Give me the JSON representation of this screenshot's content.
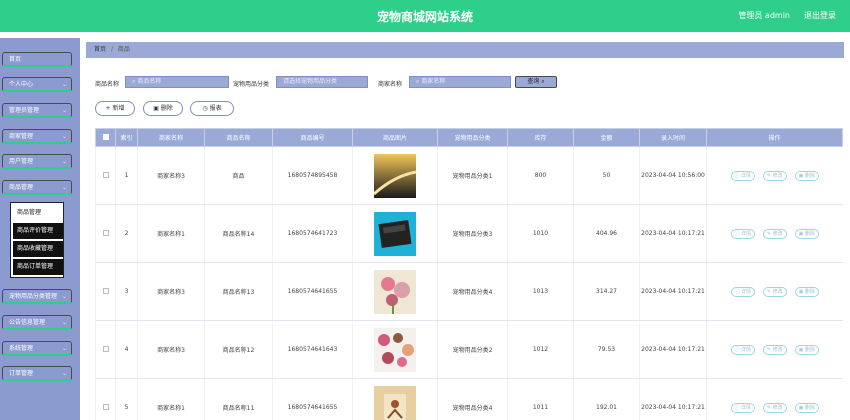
{
  "header": {
    "title": "宠物商城网站系统",
    "admin_label": "管理员 admin",
    "logout_label": "退出登录"
  },
  "sidebar": {
    "items": [
      {
        "label": "首页",
        "has_chevron": false
      },
      {
        "label": "个人中心",
        "has_chevron": true
      },
      {
        "label": "管理员管理",
        "has_chevron": true
      },
      {
        "label": "商家管理",
        "has_chevron": true
      },
      {
        "label": "用户管理",
        "has_chevron": true
      },
      {
        "label": "商品管理",
        "has_chevron": true
      },
      {
        "label": "宠物用品分类管理",
        "has_chevron": true
      },
      {
        "label": "公告信息管理",
        "has_chevron": true
      },
      {
        "label": "系统管理",
        "has_chevron": true
      },
      {
        "label": "订单管理",
        "has_chevron": true
      }
    ],
    "submenu": [
      "商品管理",
      "商品评价管理",
      "商品收藏管理",
      "商品订单管理"
    ],
    "chevron": "chevron-down-icon"
  },
  "breadcrumb": {
    "home": "首页",
    "separator": "/",
    "current": "商品"
  },
  "search": {
    "name_label": "商品名称",
    "name_placeholder": "商品名称",
    "category_label": "宠物用品分类",
    "category_placeholder": "请选择宠物用品分类",
    "shop_label": "商家名称",
    "shop_placeholder": "商家名称",
    "query_label": "查询"
  },
  "actions": {
    "add": "+ 新增",
    "delete": "删除",
    "report": "报表"
  },
  "table": {
    "headers": [
      "",
      "索引",
      "商家名称",
      "商品名称",
      "商品编号",
      "商品图片",
      "宠物用品分类",
      "库存",
      "金额",
      "录入时间",
      "操作"
    ],
    "rows": [
      {
        "index": "1",
        "shop": "商家名称3",
        "name": "商品",
        "code": "1680574895458",
        "category": "宠物用品分类1",
        "stock": "800",
        "price": "50",
        "time": "2023-04-04 10:56:00",
        "img": "road"
      },
      {
        "index": "2",
        "shop": "商家名称1",
        "name": "商品名称14",
        "code": "1680574641723",
        "category": "宠物用品分类3",
        "stock": "1010",
        "price": "404.96",
        "time": "2023-04-04 10:17:21",
        "img": "box"
      },
      {
        "index": "3",
        "shop": "商家名称3",
        "name": "商品名称13",
        "code": "1680574641655",
        "category": "宠物用品分类4",
        "stock": "1013",
        "price": "314.27",
        "time": "2023-04-04 10:17:21",
        "img": "flowers"
      },
      {
        "index": "4",
        "shop": "商家名称3",
        "name": "商品名称12",
        "code": "1680574641643",
        "category": "宠物用品分类2",
        "stock": "1012",
        "price": "79.53",
        "time": "2023-04-04 10:17:21",
        "img": "cosmetics"
      },
      {
        "index": "5",
        "shop": "商家名称1",
        "name": "商品名称11",
        "code": "1680574641655",
        "category": "宠物用品分类4",
        "stock": "1011",
        "price": "192.01",
        "time": "2023-04-04 10:17:21",
        "img": "deco"
      }
    ],
    "row_actions": [
      "详情",
      "修改",
      "删除"
    ]
  },
  "colors": {
    "green": "#2fcf8b",
    "sidebar": "#8c9bcf",
    "accent": "#9aa9d6"
  }
}
